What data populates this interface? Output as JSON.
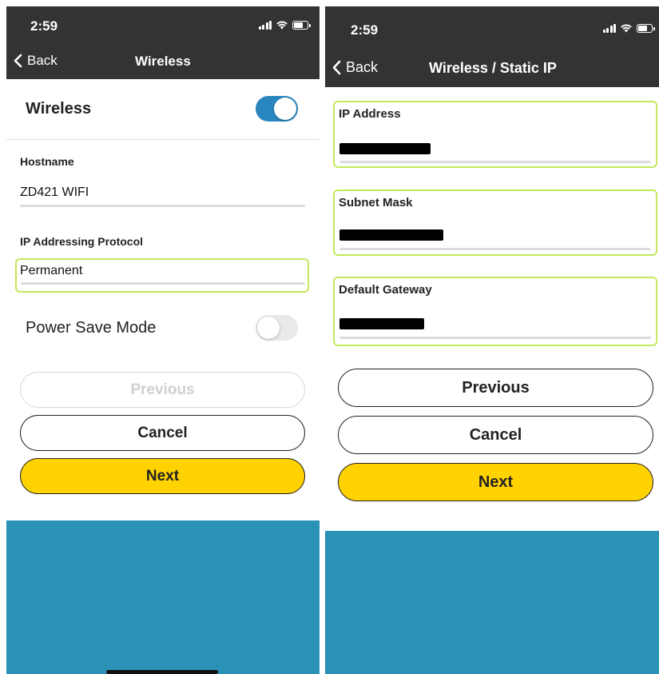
{
  "left_screen": {
    "status_time": "2:59",
    "nav": {
      "back_label": "Back",
      "title": "Wireless"
    },
    "wireless": {
      "label": "Wireless",
      "enabled": true
    },
    "hostname": {
      "label": "Hostname",
      "value": "ZD421 WIFI"
    },
    "ip_protocol": {
      "label": "IP Addressing Protocol",
      "value": "Permanent"
    },
    "power_save": {
      "label": "Power Save Mode",
      "enabled": false
    },
    "buttons": {
      "previous": "Previous",
      "cancel": "Cancel",
      "next": "Next"
    }
  },
  "right_screen": {
    "status_time": "2:59",
    "nav": {
      "back_label": "Back",
      "title": "Wireless / Static IP"
    },
    "fields": [
      {
        "label": "IP Address"
      },
      {
        "label": "Subnet Mask"
      },
      {
        "label": "Default Gateway"
      }
    ],
    "buttons": {
      "previous": "Previous",
      "cancel": "Cancel",
      "next": "Next"
    }
  },
  "colors": {
    "top_bar": "#333333",
    "toggle_on": "#2a86be",
    "highlight": "#c5e85d",
    "primary_button": "#ffd200",
    "footer": "#2a92b5"
  },
  "icons": [
    "signal-icon",
    "wifi-icon",
    "battery-icon",
    "chevron-left-icon"
  ]
}
